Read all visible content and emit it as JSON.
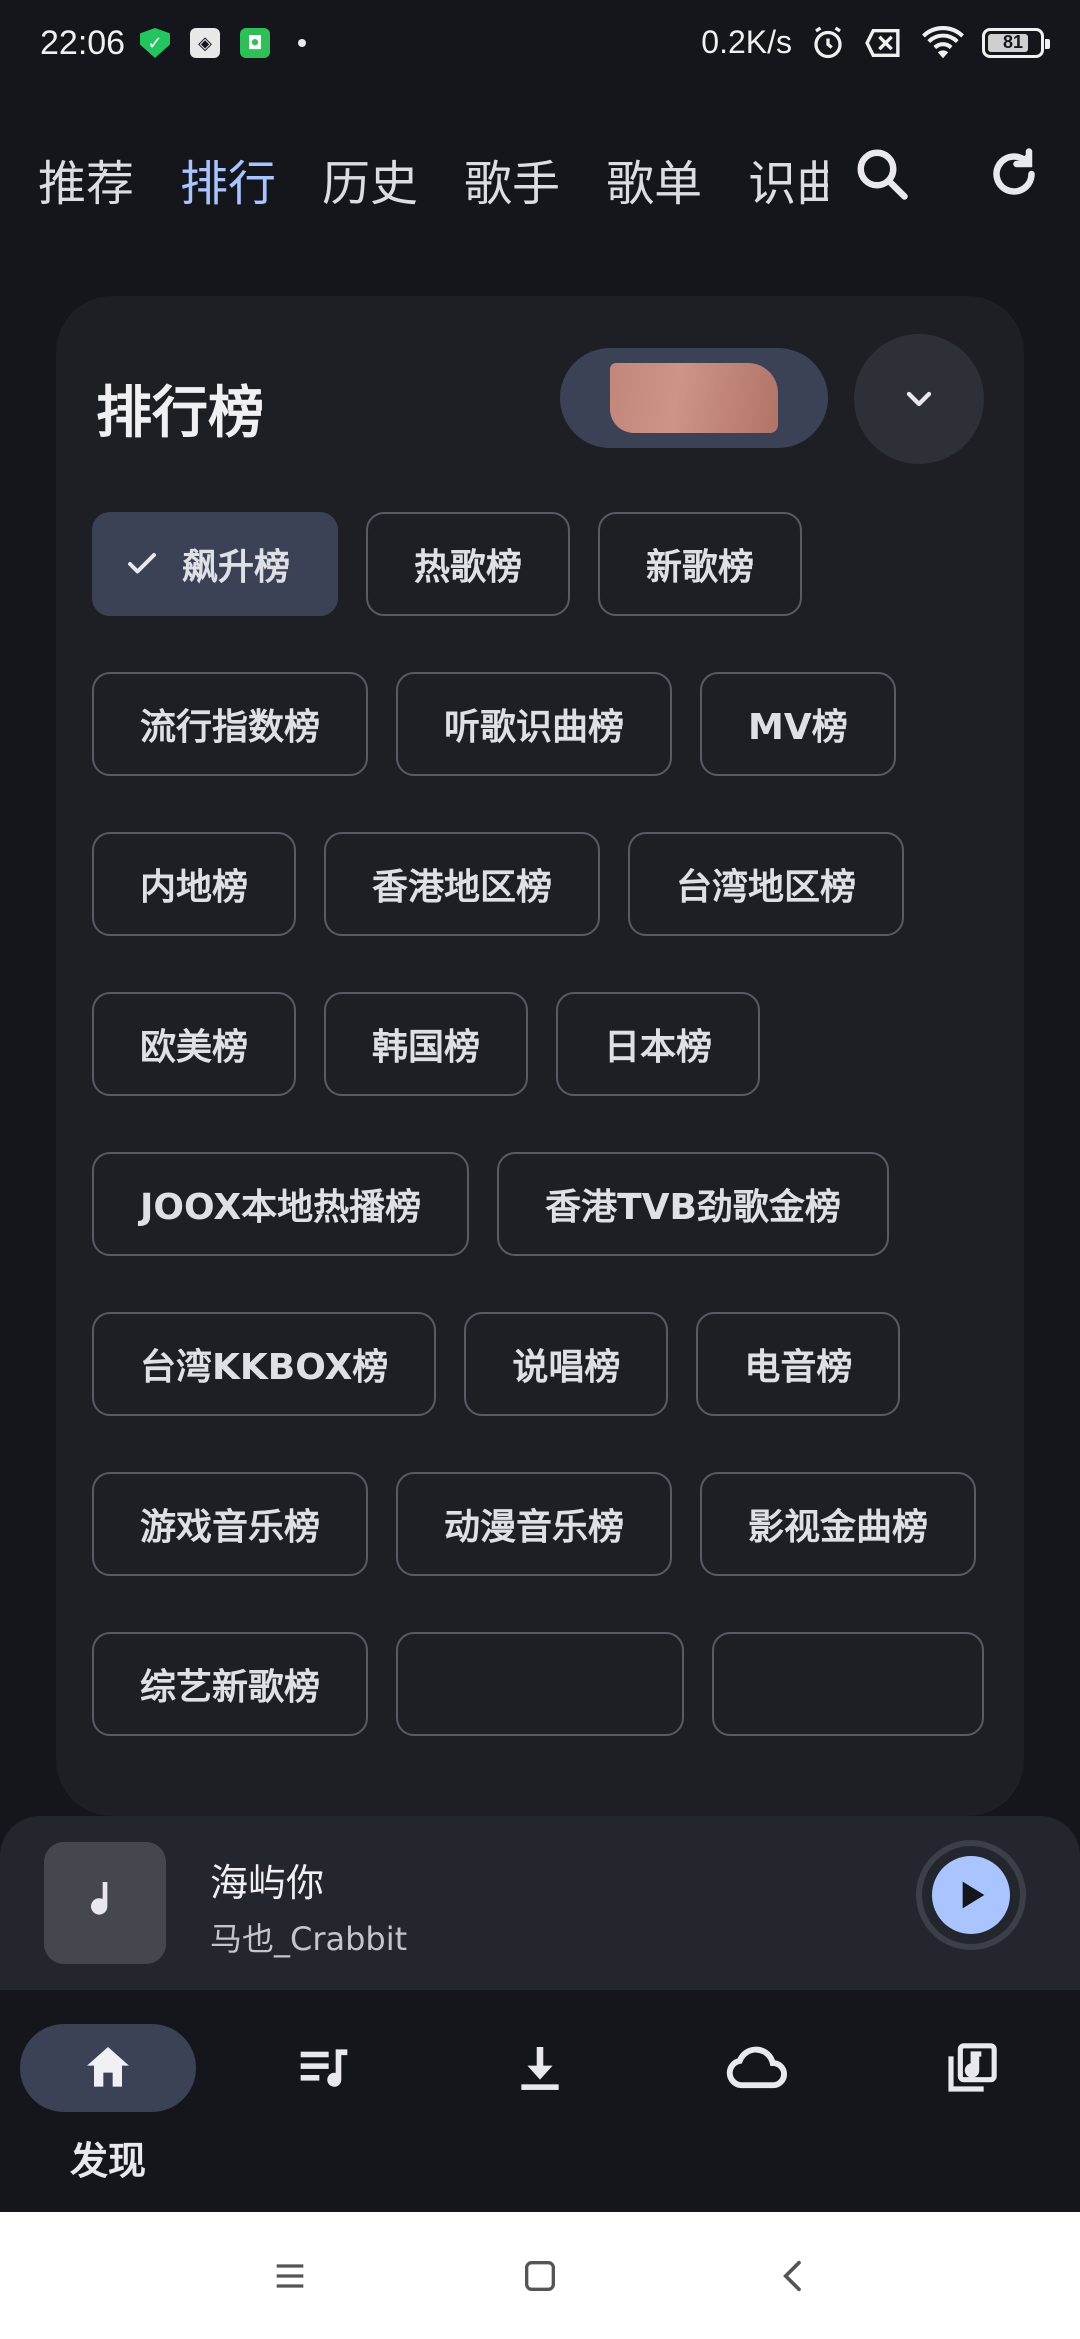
{
  "status_bar": {
    "time": "22:06",
    "net_speed": "0.2K/s",
    "battery": "81",
    "left_icons": [
      "shield-icon",
      "app-icon",
      "android-icon"
    ],
    "right_icons": [
      "alarm-icon",
      "sim-off-icon",
      "wifi-icon",
      "battery-icon"
    ]
  },
  "top_nav": {
    "tabs": [
      {
        "label": "推荐",
        "active": false
      },
      {
        "label": "排行",
        "active": true
      },
      {
        "label": "历史",
        "active": false
      },
      {
        "label": "歌手",
        "active": false
      },
      {
        "label": "歌单",
        "active": false
      },
      {
        "label": "识曲",
        "active": false
      }
    ],
    "icons": [
      "search-icon",
      "refresh-icon"
    ]
  },
  "ranking": {
    "title": "排行榜",
    "charts": [
      {
        "label": "飙升榜",
        "selected": true
      },
      {
        "label": "热歌榜",
        "selected": false
      },
      {
        "label": "新歌榜",
        "selected": false
      },
      {
        "label": "流行指数榜",
        "selected": false
      },
      {
        "label": "听歌识曲榜",
        "selected": false
      },
      {
        "label": "MV榜",
        "selected": false
      },
      {
        "label": "内地榜",
        "selected": false
      },
      {
        "label": "香港地区榜",
        "selected": false
      },
      {
        "label": "台湾地区榜",
        "selected": false
      },
      {
        "label": "欧美榜",
        "selected": false
      },
      {
        "label": "韩国榜",
        "selected": false
      },
      {
        "label": "日本榜",
        "selected": false
      },
      {
        "label": "JOOX本地热播榜",
        "selected": false
      },
      {
        "label": "香港TVB劲歌金榜",
        "selected": false
      },
      {
        "label": "台湾KKBOX榜",
        "selected": false
      },
      {
        "label": "说唱榜",
        "selected": false
      },
      {
        "label": "电音榜",
        "selected": false
      },
      {
        "label": "游戏音乐榜",
        "selected": false
      },
      {
        "label": "动漫音乐榜",
        "selected": false
      },
      {
        "label": "影视金曲榜",
        "selected": false
      },
      {
        "label": "综艺新歌榜",
        "selected": false
      },
      {
        "label": "",
        "selected": false
      },
      {
        "label": "",
        "selected": false
      }
    ]
  },
  "player": {
    "title": "海屿你",
    "artist": "马也_Crabbit"
  },
  "bottom_nav": {
    "items": [
      {
        "icon": "home-icon",
        "label": "发现",
        "active": true
      },
      {
        "icon": "playlist-icon",
        "label": "",
        "active": false
      },
      {
        "icon": "download-icon",
        "label": "",
        "active": false
      },
      {
        "icon": "cloud-icon",
        "label": "",
        "active": false
      },
      {
        "icon": "library-icon",
        "label": "",
        "active": false
      }
    ]
  },
  "colors": {
    "background": "#14161b",
    "card": "#1d1f25",
    "accent": "#a9c4ff",
    "chip_selected": "#3b4256",
    "chip_border": "#585b64"
  }
}
